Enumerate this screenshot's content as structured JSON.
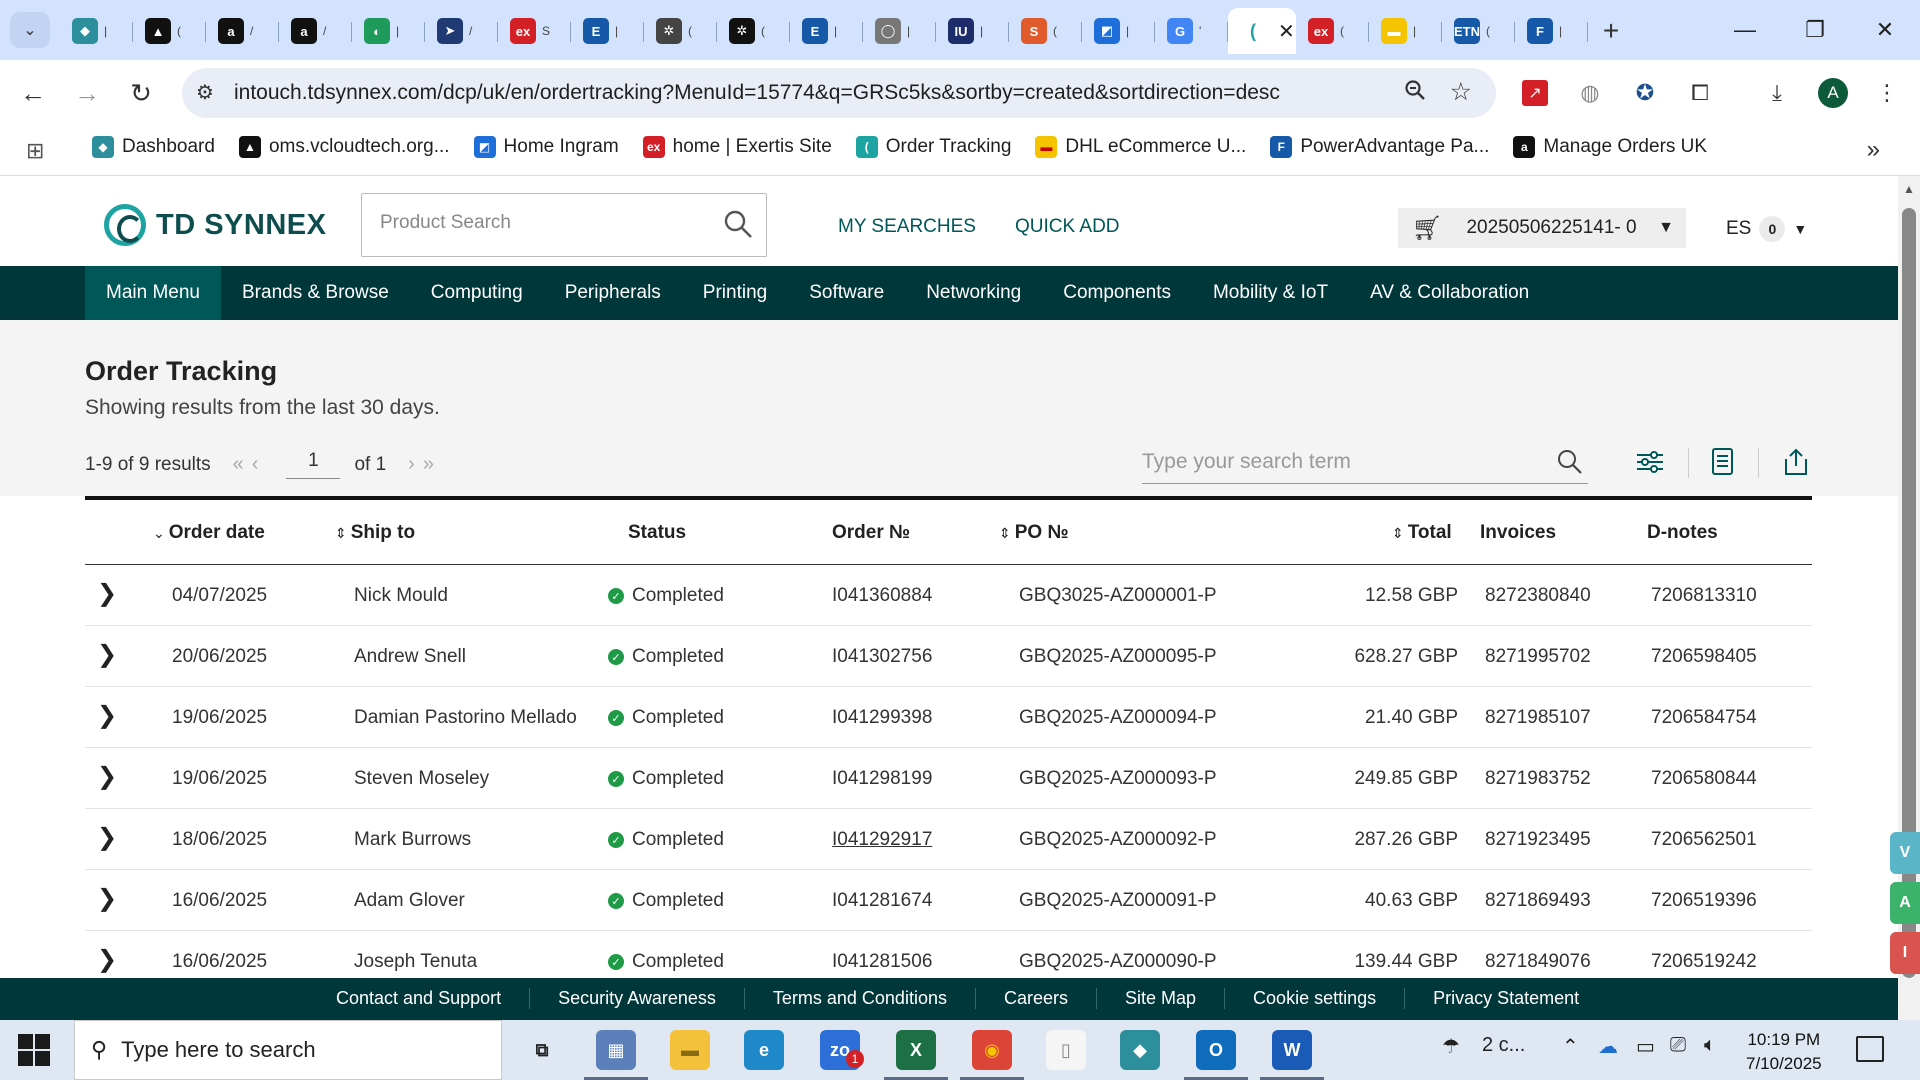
{
  "browser": {
    "tabs": [
      {
        "icon": "cloud-tab-icon",
        "glyph": "◆",
        "color": "#2d8f9b",
        "dots": "|"
      },
      {
        "icon": "vercel-tab-icon",
        "glyph": "▲",
        "color": "#111111",
        "dots": "("
      },
      {
        "icon": "amazon-tab-icon",
        "glyph": "a",
        "color": "#111111",
        "dots": "/"
      },
      {
        "icon": "amazon-tab-icon",
        "glyph": "a",
        "color": "#111111",
        "dots": "/"
      },
      {
        "icon": "green-tab-icon",
        "glyph": "◐",
        "color": "#1e9a5a",
        "dots": "|"
      },
      {
        "icon": "arrow-tab-icon",
        "glyph": "➤",
        "color": "#203a73",
        "dots": "/"
      },
      {
        "icon": "exertis-tab-icon",
        "glyph": "ex",
        "color": "#d32027",
        "dots": "S"
      },
      {
        "icon": "e-tab-icon",
        "glyph": "E",
        "color": "#1559a8",
        "dots": "|"
      },
      {
        "icon": "openai-tab-icon",
        "glyph": "✲",
        "color": "#444444",
        "dots": "("
      },
      {
        "icon": "openai-tab-icon",
        "glyph": "✲",
        "color": "#111111",
        "dots": "("
      },
      {
        "icon": "e-tab-icon",
        "glyph": "E",
        "color": "#1559a8",
        "dots": "|"
      },
      {
        "icon": "bulb-tab-icon",
        "glyph": "◯",
        "color": "#777777",
        "dots": "|"
      },
      {
        "icon": "rw-tab-icon",
        "glyph": "IU",
        "color": "#1d2d6b",
        "dots": "|"
      },
      {
        "icon": "hubspot-tab-icon",
        "glyph": "S",
        "color": "#e05a2b",
        "dots": "("
      },
      {
        "icon": "blue-tab-icon",
        "glyph": "◩",
        "color": "#1d6ed8",
        "dots": "|"
      },
      {
        "icon": "google-tab-icon",
        "glyph": "G",
        "color": "#4285f4",
        "dots": "'"
      },
      {
        "icon": "tdsynnex-tab-icon",
        "glyph": "(",
        "color": "#1ea3a3",
        "dots": "",
        "active": true
      },
      {
        "icon": "exertis-tab-icon",
        "glyph": "ex",
        "color": "#d32027",
        "dots": "("
      },
      {
        "icon": "dhl-tab-icon",
        "glyph": "▬",
        "color": "#f5c400",
        "dots": "|"
      },
      {
        "icon": "etn-tab-icon",
        "glyph": "ETN",
        "color": "#1559a8",
        "dots": "("
      },
      {
        "icon": "forms-tab-icon",
        "glyph": "F",
        "color": "#1559a8",
        "dots": "|"
      }
    ],
    "url": "intouch.tdsynnex.com/dcp/uk/en/ordertracking?MenuId=15774&q=GRSc5ks&sortby=created&sortdirection=desc",
    "avatar": "A",
    "bookmarks": [
      {
        "label": "Dashboard",
        "icon": "cloud-bookmark-icon",
        "glyph": "◆",
        "color": "#2d8f9b"
      },
      {
        "label": "oms.vcloudtech.org...",
        "icon": "vercel-bookmark-icon",
        "glyph": "▲",
        "color": "#111111"
      },
      {
        "label": "Home Ingram",
        "icon": "ingram-bookmark-icon",
        "glyph": "◩",
        "color": "#1d6ed8"
      },
      {
        "label": "home | Exertis Site",
        "icon": "exertis-bookmark-icon",
        "glyph": "ex",
        "color": "#d32027"
      },
      {
        "label": "Order Tracking",
        "icon": "tdsynnex-bookmark-icon",
        "glyph": "(",
        "color": "#1ea3a3"
      },
      {
        "label": "DHL eCommerce U...",
        "icon": "dhl-bookmark-icon",
        "glyph": "▬",
        "color": "#f5c400"
      },
      {
        "label": "PowerAdvantage Pa...",
        "icon": "forms-bookmark-icon",
        "glyph": "F",
        "color": "#1559a8"
      },
      {
        "label": "Manage Orders UK",
        "icon": "amazon-bookmark-icon",
        "glyph": "a",
        "color": "#111111"
      }
    ]
  },
  "header": {
    "logo_text": "TD SYNNEX",
    "search_placeholder": "Product Search",
    "my_searches": "MY SEARCHES",
    "quick_add": "QUICK ADD",
    "cart_id": "20250506225141- 0",
    "user_initials": "ES",
    "user_count": "0"
  },
  "nav": [
    "Main Menu",
    "Brands & Browse",
    "Computing",
    "Peripherals",
    "Printing",
    "Software",
    "Networking",
    "Components",
    "Mobility & IoT",
    "AV & Collaboration"
  ],
  "page": {
    "title": "Order Tracking",
    "subtitle": "Showing results from the last 30 days.",
    "results": "1-9 of 9 results",
    "page": "1",
    "of": "of 1",
    "search_placeholder": "Type your search term"
  },
  "table": {
    "headers": [
      "Order date",
      "Ship to",
      "Status",
      "Order №",
      "PO №",
      "Total",
      "Invoices",
      "D-notes"
    ],
    "rows": [
      {
        "date": "04/07/2025",
        "ship_to": "Nick Mould",
        "status": "Completed",
        "order": "I041360884",
        "po": "GBQ3025-AZ000001-P",
        "total": "12.58 GBP",
        "invoice": "8272380840",
        "dnote": "7206813310"
      },
      {
        "date": "20/06/2025",
        "ship_to": "Andrew Snell",
        "status": "Completed",
        "order": "I041302756",
        "po": "GBQ2025-AZ000095-P",
        "total": "628.27 GBP",
        "invoice": "8271995702",
        "dnote": "7206598405"
      },
      {
        "date": "19/06/2025",
        "ship_to": "Damian Pastorino Mellado",
        "status": "Completed",
        "order": "I041299398",
        "po": "GBQ2025-AZ000094-P",
        "total": "21.40 GBP",
        "invoice": "8271985107",
        "dnote": "7206584754"
      },
      {
        "date": "19/06/2025",
        "ship_to": "Steven Moseley",
        "status": "Completed",
        "order": "I041298199",
        "po": "GBQ2025-AZ000093-P",
        "total": "249.85 GBP",
        "invoice": "8271983752",
        "dnote": "7206580844"
      },
      {
        "date": "18/06/2025",
        "ship_to": "Mark Burrows",
        "status": "Completed",
        "order": "I041292917",
        "po": "GBQ2025-AZ000092-P",
        "total": "287.26 GBP",
        "invoice": "8271923495",
        "dnote": "7206562501",
        "hover": true
      },
      {
        "date": "16/06/2025",
        "ship_to": "Adam Glover",
        "status": "Completed",
        "order": "I041281674",
        "po": "GBQ2025-AZ000091-P",
        "total": "40.63 GBP",
        "invoice": "8271869493",
        "dnote": "7206519396"
      },
      {
        "date": "16/06/2025",
        "ship_to": "Joseph Tenuta",
        "status": "Completed",
        "order": "I041281506",
        "po": "GBQ2025-AZ000090-P",
        "total": "139.44 GBP",
        "invoice": "8271849076",
        "dnote": "7206519242"
      }
    ]
  },
  "footer": [
    "Contact and Support",
    "Security Awareness",
    "Terms and Conditions",
    "Careers",
    "Site Map",
    "Cookie settings",
    "Privacy Statement"
  ],
  "side_widgets": [
    {
      "glyph": "V",
      "color": "#5bb5c9"
    },
    {
      "glyph": "A",
      "color": "#3bb36a"
    },
    {
      "glyph": "I",
      "color": "#d9534f"
    }
  ],
  "taskbar": {
    "search_placeholder": "Type here to search",
    "weather": "2 c...",
    "time": "10:19 PM",
    "date": "7/10/2025",
    "teams_badge": "1",
    "apps": [
      {
        "name": "task-view-icon",
        "glyph": "⧉",
        "color": "#dfe7f3",
        "fg": "#222222"
      },
      {
        "name": "calculator-icon",
        "glyph": "▦",
        "color": "#5b7fb8",
        "fg": "#ffffff",
        "running": true
      },
      {
        "name": "file-explorer-icon",
        "glyph": "▬",
        "color": "#f3c13a",
        "fg": "#8a6a12"
      },
      {
        "name": "edge-icon",
        "glyph": "e",
        "color": "#1e88c9",
        "fg": "#ffffff"
      },
      {
        "name": "zoom-icon",
        "glyph": "zo",
        "color": "#2d6fd8",
        "fg": "#ffffff"
      },
      {
        "name": "excel-icon",
        "glyph": "X",
        "color": "#1d7044",
        "fg": "#ffffff",
        "running": true
      },
      {
        "name": "chrome-icon",
        "glyph": "◉",
        "color": "#db4437",
        "fg": "#f5c400",
        "running": true
      },
      {
        "name": "notepad-icon",
        "glyph": "▯",
        "color": "#f5f5f5",
        "fg": "#888888"
      },
      {
        "name": "azure-icon",
        "glyph": "◆",
        "color": "#2d8f9b",
        "fg": "#ffffff"
      },
      {
        "name": "outlook-icon",
        "glyph": "O",
        "color": "#0f6cbd",
        "fg": "#ffffff",
        "running": true
      },
      {
        "name": "word-icon",
        "glyph": "W",
        "color": "#1a5bb8",
        "fg": "#ffffff",
        "running": true
      }
    ]
  }
}
